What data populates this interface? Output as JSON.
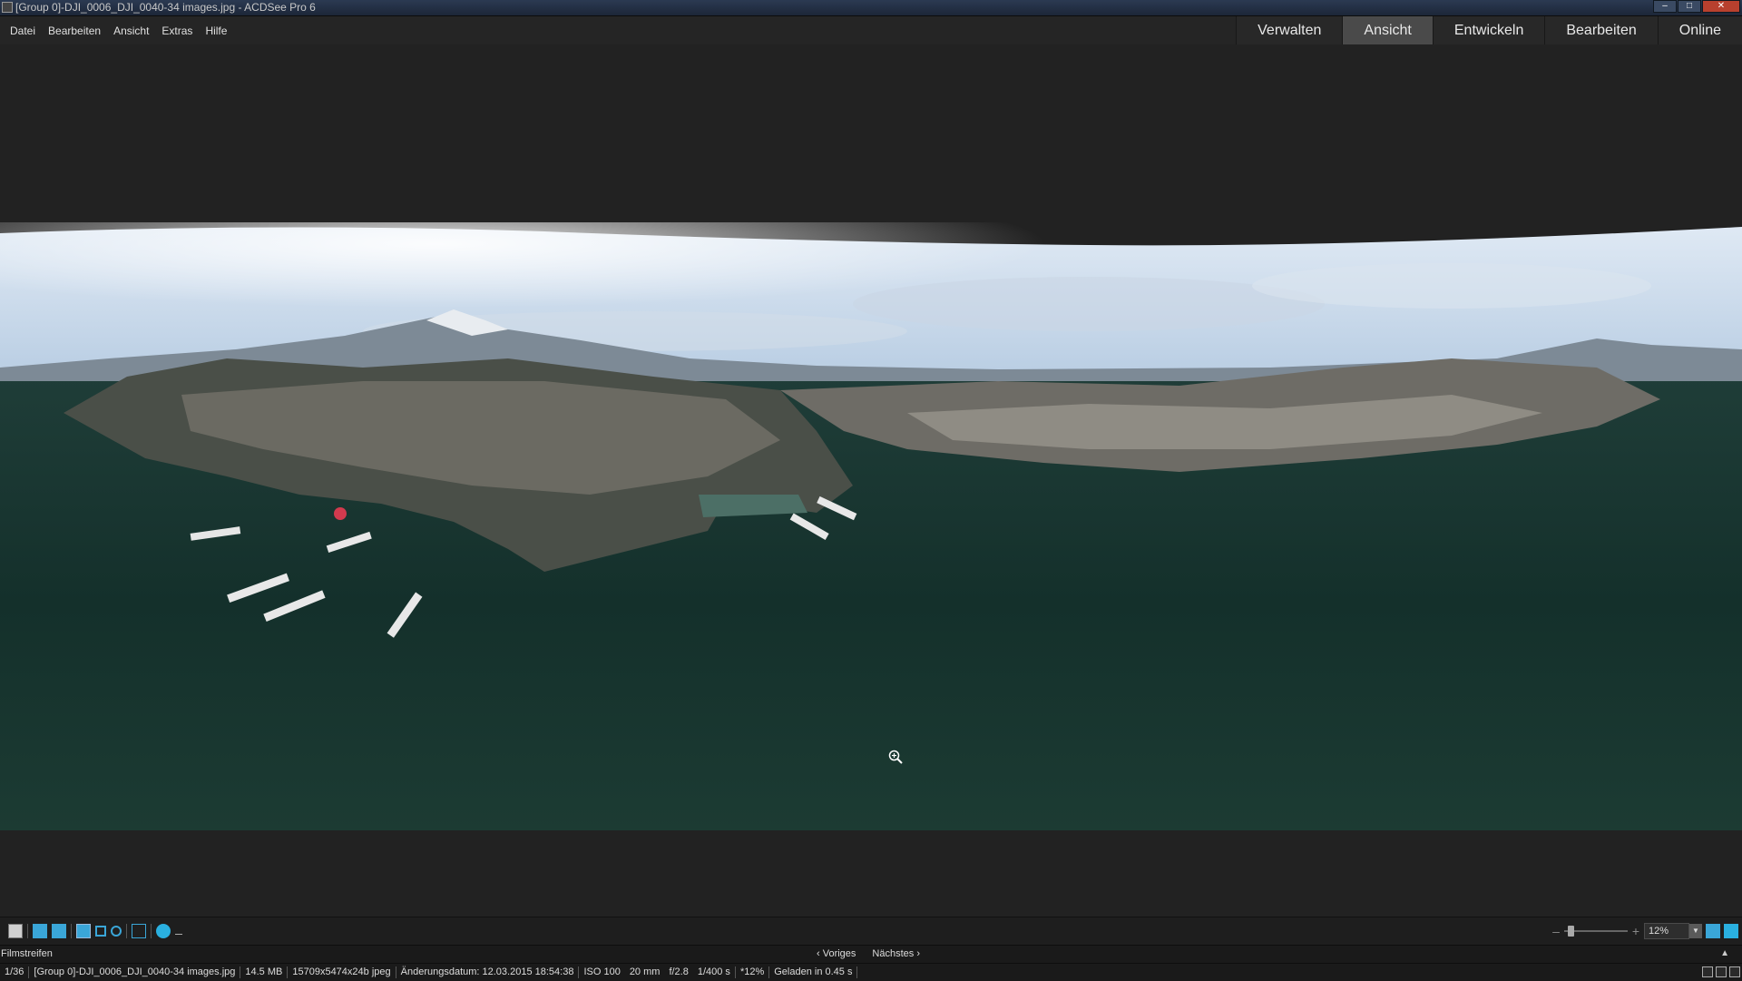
{
  "window": {
    "title": "[Group 0]-DJI_0006_DJI_0040-34 images.jpg - ACDSee Pro 6",
    "minimize": "–",
    "maximize": "□",
    "close": "✕"
  },
  "menu": {
    "items": [
      "Datei",
      "Bearbeiten",
      "Ansicht",
      "Extras",
      "Hilfe"
    ]
  },
  "modes": {
    "items": [
      "Verwalten",
      "Ansicht",
      "Entwickeln",
      "Bearbeiten",
      "Online"
    ],
    "active": "Ansicht"
  },
  "viewer": {
    "cursor": "zoom-in-icon"
  },
  "toolbar": {
    "zoom_minus": "–",
    "zoom_plus": "+",
    "zoom_value": "12%",
    "zoom_level": 0.12,
    "zoom_drop": "▼"
  },
  "filmstrip": {
    "label": "Filmstreifen",
    "prev": "‹ Voriges",
    "next": "Nächstes ›",
    "collapse": "▲"
  },
  "status": {
    "index": "1/36",
    "filename": "[Group 0]-DJI_0006_DJI_0040-34 images.jpg",
    "size": "14.5 MB",
    "dimensions": "15709x5474x24b jpeg",
    "modified": "Änderungsdatum: 12.03.2015 18:54:38",
    "iso": "ISO 100",
    "focal": "20 mm",
    "aperture": "f/2.8",
    "shutter": "1/400 s",
    "zoom": "*12%",
    "loaded": "Geladen in 0.45 s"
  },
  "colors": {
    "accent": "#3aa6d8",
    "close": "#b8402e",
    "active_tab": "#4a4a4a"
  }
}
